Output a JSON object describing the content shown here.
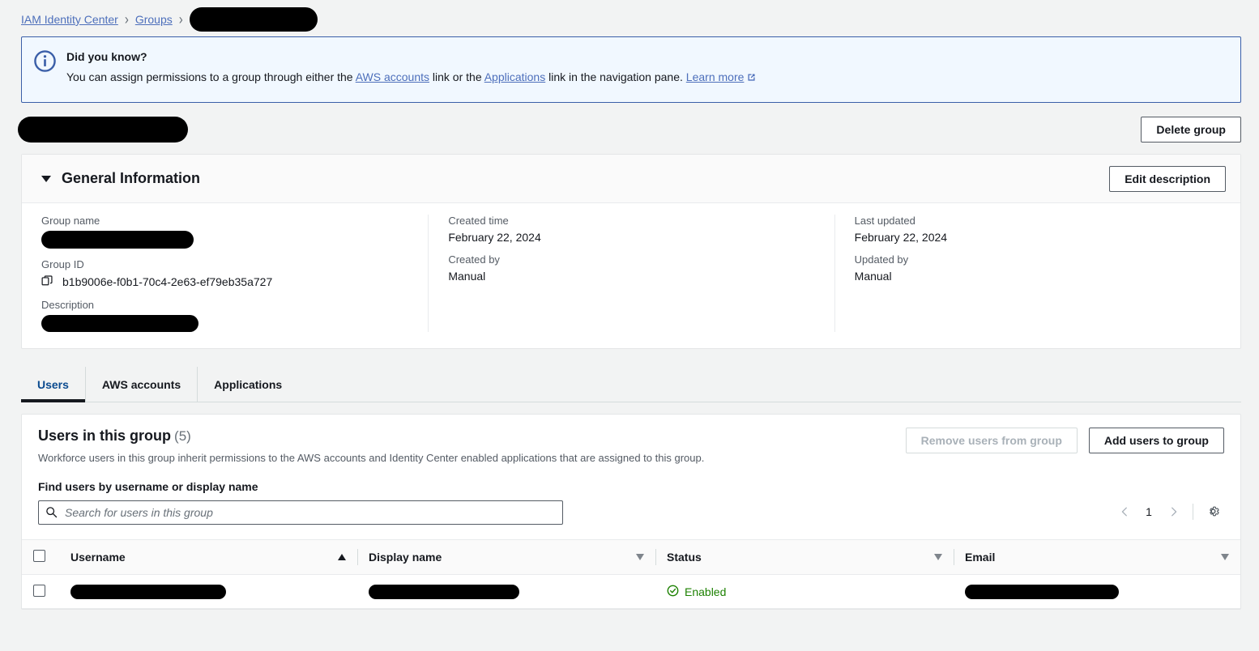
{
  "breadcrumb": {
    "items": [
      {
        "label": "IAM Identity Center",
        "type": "link"
      },
      {
        "label": "Groups",
        "type": "link"
      },
      {
        "label": "",
        "type": "redacted"
      }
    ]
  },
  "banner": {
    "icon": "info-icon",
    "title": "Did you know?",
    "text_before": "You can assign permissions to a group through either the ",
    "link1": "AWS accounts",
    "text_mid1": " link or the ",
    "link2": "Applications",
    "text_mid2": " link in the navigation pane. ",
    "learn_more": "Learn more",
    "external_icon": "external-link-icon"
  },
  "page": {
    "title": "",
    "delete_button": "Delete group"
  },
  "general_information": {
    "section_title": "General Information",
    "edit_button": "Edit description",
    "fields": {
      "group_name_label": "Group name",
      "group_name_value": "",
      "group_id_label": "Group ID",
      "group_id_value": "b1b9006e-f0b1-70c4-2e63-ef79eb35a727",
      "group_id_copy_icon": "copy-icon",
      "description_label": "Description",
      "description_value": "",
      "created_time_label": "Created time",
      "created_time_value": "February 22, 2024",
      "created_by_label": "Created by",
      "created_by_value": "Manual",
      "last_updated_label": "Last updated",
      "last_updated_value": "February 22, 2024",
      "updated_by_label": "Updated by",
      "updated_by_value": "Manual"
    }
  },
  "tabs": [
    {
      "label": "Users",
      "active": true
    },
    {
      "label": "AWS accounts",
      "active": false
    },
    {
      "label": "Applications",
      "active": false
    }
  ],
  "users_panel": {
    "title": "Users in this group",
    "count": "(5)",
    "subtitle": "Workforce users in this group inherit permissions to the AWS accounts and Identity Center enabled applications that are assigned to this group.",
    "remove_button": "Remove users from group",
    "add_button": "Add users to group",
    "search_label": "Find users by username or display name",
    "search_placeholder": "Search for users in this group",
    "search_value": "",
    "search_icon": "search-icon",
    "pagination": {
      "prev_icon": "chevron-left-icon",
      "page": "1",
      "next_icon": "chevron-right-icon",
      "settings_icon": "gear-icon"
    },
    "table": {
      "columns": [
        {
          "label": "Username",
          "sort": "asc"
        },
        {
          "label": "Display name",
          "sort": "none"
        },
        {
          "label": "Status",
          "sort": "none"
        },
        {
          "label": "Email",
          "sort": "none"
        }
      ],
      "rows": [
        {
          "username": "",
          "display_name": "",
          "status": "Enabled",
          "status_icon": "check-circle-icon",
          "email": ""
        }
      ]
    }
  },
  "colors": {
    "link": "#4d6fbb",
    "banner_bg": "#f1f8ff",
    "banner_border": "#3b5fa8",
    "status_green": "#1d8102",
    "tab_active": "#0a4a8f",
    "page_bg": "#f2f3f3"
  }
}
